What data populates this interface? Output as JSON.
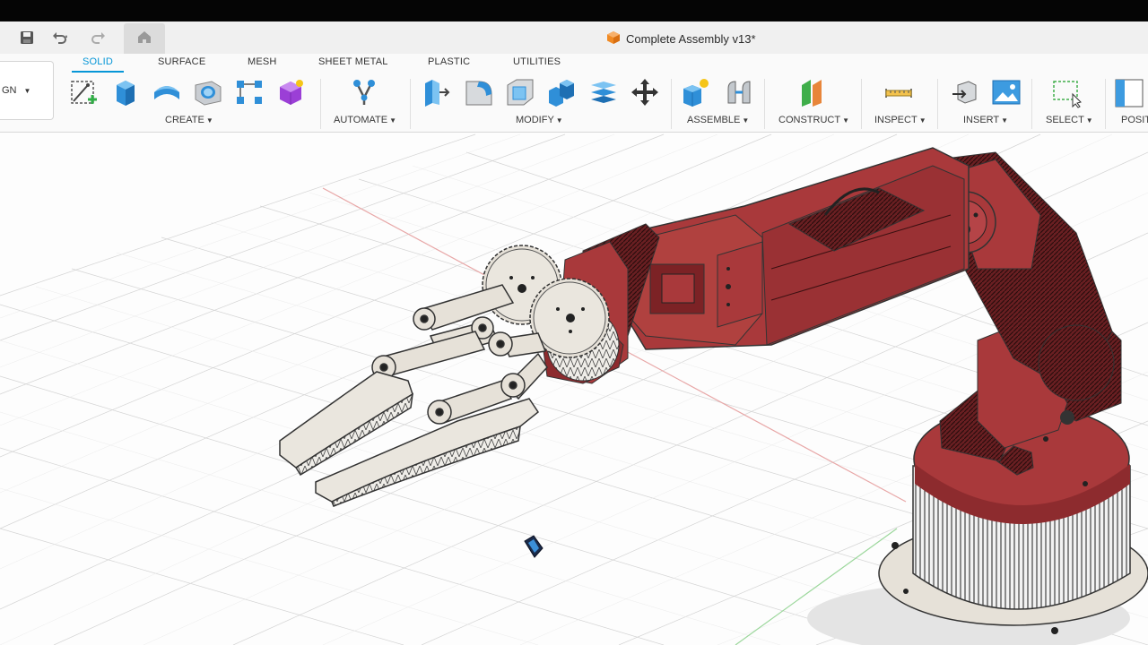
{
  "document": {
    "title": "Complete Assembly v13*"
  },
  "workspace": {
    "label": "GN"
  },
  "tabs": [
    {
      "label": "SOLID",
      "active": true
    },
    {
      "label": "SURFACE",
      "active": false
    },
    {
      "label": "MESH",
      "active": false
    },
    {
      "label": "SHEET METAL",
      "active": false
    },
    {
      "label": "PLASTIC",
      "active": false
    },
    {
      "label": "UTILITIES",
      "active": false
    }
  ],
  "groups": {
    "create": "CREATE",
    "automate": "AUTOMATE",
    "modify": "MODIFY",
    "assemble": "ASSEMBLE",
    "construct": "CONSTRUCT",
    "inspect": "INSPECT",
    "insert": "INSERT",
    "select": "SELECT",
    "position": "POSIT"
  },
  "colors": {
    "accent": "#0696d7",
    "model_red": "#a9393b",
    "model_gray": "#e6e1d8",
    "doc_icon": "#f08a24"
  },
  "icons": [
    "save-icon",
    "undo-icon",
    "redo-icon",
    "home-icon",
    "create-sketch-icon",
    "extrude-icon",
    "revolve-icon",
    "hole-icon",
    "rectangular-pattern-icon",
    "form-icon",
    "automate-icon",
    "press-pull-icon",
    "fillet-icon",
    "shell-icon",
    "combine-icon",
    "offset-plane-icon",
    "move-icon",
    "new-component-icon",
    "joint-icon",
    "construct-plane-icon",
    "measure-icon",
    "insert-mesh-icon",
    "insert-image-icon",
    "select-icon",
    "position-icon"
  ]
}
